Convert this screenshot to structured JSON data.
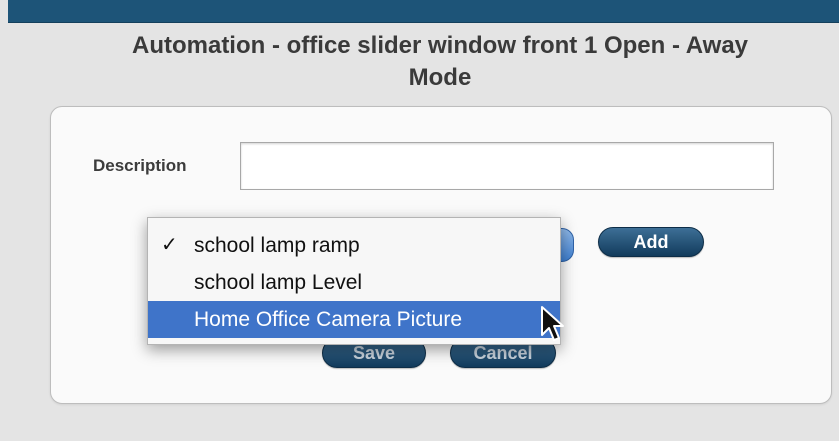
{
  "page": {
    "title_line1": "Automation - office slider window front 1 Open - Away",
    "title_line2": "Mode"
  },
  "form": {
    "description_label": "Description",
    "description_value": "",
    "add_label": "Add",
    "save_label": "Save",
    "cancel_label": "Cancel"
  },
  "dropdown": {
    "items": [
      {
        "label": "school lamp ramp",
        "checked": true,
        "highlighted": false
      },
      {
        "label": "school lamp Level",
        "checked": false,
        "highlighted": false
      },
      {
        "label": "Home Office Camera Picture",
        "checked": false,
        "highlighted": true
      }
    ],
    "check_glyph": "✓"
  },
  "colors": {
    "header_bar": "#1d5478",
    "button": "#1a4566",
    "highlight": "#3f74c9"
  },
  "icons": {
    "cursor": "arrow-cursor-icon"
  }
}
